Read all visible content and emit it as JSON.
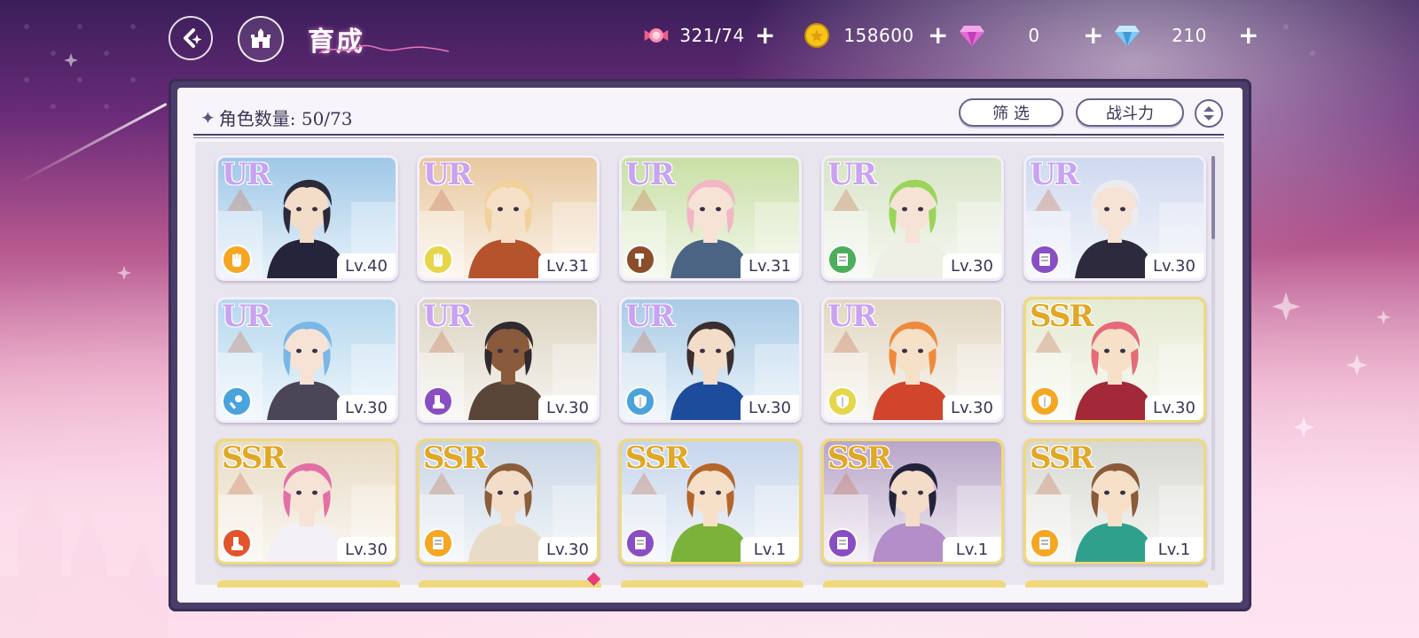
{
  "header": {
    "title": "育成",
    "title_script": "Uwin",
    "back_icon": "back-arrow-icon",
    "home_icon": "castle-home-icon"
  },
  "currencies": [
    {
      "name": "candy",
      "icon": "candy-icon",
      "value": "321/74",
      "color": "#f05a8a"
    },
    {
      "name": "coin",
      "icon": "gold-coin-icon",
      "value": "158600",
      "color": "#f5c518"
    },
    {
      "name": "pink-diamond",
      "icon": "pink-diamond-icon",
      "value": "0",
      "color": "#e46bd6"
    },
    {
      "name": "blue-diamond",
      "icon": "blue-diamond-icon",
      "value": "210",
      "color": "#7ec8f5"
    }
  ],
  "panel": {
    "count_label": "角色数量: 50/73",
    "filter_label": "筛 选",
    "sort_label": "战斗力"
  },
  "cards": [
    {
      "rarity": "UR",
      "level": "Lv.40",
      "role_color": "#f5a623",
      "role_icon": "fist-icon",
      "hair": "#2b2a3a",
      "skin": "#f3dcc8",
      "outfit": "#25243a",
      "bg": "#9fc8e8"
    },
    {
      "rarity": "UR",
      "level": "Lv.31",
      "role_color": "#e5d64a",
      "role_icon": "fist-icon",
      "hair": "#f0d29a",
      "skin": "#f6e0c8",
      "outfit": "#b4532c",
      "bg": "#e9c9a0"
    },
    {
      "rarity": "UR",
      "level": "Lv.31",
      "role_color": "#8a4e2c",
      "role_icon": "hammer-icon",
      "hair": "#f2b6c6",
      "skin": "#f6e3d6",
      "outfit": "#4b6484",
      "bg": "#c9dfa6"
    },
    {
      "rarity": "UR",
      "level": "Lv.30",
      "role_color": "#4cae5c",
      "role_icon": "book-icon",
      "hair": "#9ad45a",
      "skin": "#f6e3d6",
      "outfit": "#eef0e6",
      "bg": "#d8e4c8"
    },
    {
      "rarity": "UR",
      "level": "Lv.30",
      "role_color": "#8a4ec4",
      "role_icon": "book-icon",
      "hair": "#ecebf0",
      "skin": "#f6e3d6",
      "outfit": "#2c2a3c",
      "bg": "#cfd9ef"
    },
    {
      "rarity": "UR",
      "level": "Lv.30",
      "role_color": "#4aa3dc",
      "role_icon": "wand-icon",
      "hair": "#7ab6e6",
      "skin": "#f6e3d6",
      "outfit": "#4a4658",
      "bg": "#b6d8ef"
    },
    {
      "rarity": "UR",
      "level": "Lv.30",
      "role_color": "#8a4ec4",
      "role_icon": "boot-icon",
      "hair": "#2f2a2e",
      "skin": "#8a5a3c",
      "outfit": "#5a4638",
      "bg": "#dcd4c2"
    },
    {
      "rarity": "UR",
      "level": "Lv.30",
      "role_color": "#4aa3dc",
      "role_icon": "shield-icon",
      "hair": "#3b2e2e",
      "skin": "#f3dcc8",
      "outfit": "#1e4c9c",
      "bg": "#a9cbe7"
    },
    {
      "rarity": "UR",
      "level": "Lv.30",
      "role_color": "#e5d64a",
      "role_icon": "shield-icon",
      "hair": "#ee8a3c",
      "skin": "#f6e0c8",
      "outfit": "#d0452c",
      "bg": "#e2d7c2"
    },
    {
      "rarity": "SSR",
      "level": "Lv.30",
      "role_color": "#f5a623",
      "role_icon": "shield-icon",
      "hair": "#e66a7a",
      "skin": "#f6e0c8",
      "outfit": "#a32838",
      "bg": "#e5ead2"
    },
    {
      "rarity": "SSR",
      "level": "Lv.30",
      "role_color": "#e2542c",
      "role_icon": "boot-icon",
      "hair": "#e46ea6",
      "skin": "#f6e3d6",
      "outfit": "#f3f0f6",
      "bg": "#e9dcc6"
    },
    {
      "rarity": "SSR",
      "level": "Lv.30",
      "role_color": "#f5a623",
      "role_icon": "book-icon",
      "hair": "#8a5e3a",
      "skin": "#f3dcc8",
      "outfit": "#e8dcc8",
      "bg": "#c9d6e6"
    },
    {
      "rarity": "SSR",
      "level": "Lv.1",
      "role_color": "#8a4ec4",
      "role_icon": "book-icon",
      "hair": "#b5652a",
      "skin": "#f6e0c8",
      "outfit": "#7bb23a",
      "bg": "#c7d6ec"
    },
    {
      "rarity": "SSR",
      "level": "Lv.1",
      "role_color": "#8a4ec4",
      "role_icon": "book-icon",
      "hair": "#22223a",
      "skin": "#f3dcc8",
      "outfit": "#b48ec8",
      "bg": "#b9a6c8"
    },
    {
      "rarity": "SSR",
      "level": "Lv.1",
      "role_color": "#f5a623",
      "role_icon": "book-icon",
      "hair": "#8a5a3a",
      "skin": "#f6e0c8",
      "outfit": "#2fa08c",
      "bg": "#d8d9d2"
    }
  ]
}
